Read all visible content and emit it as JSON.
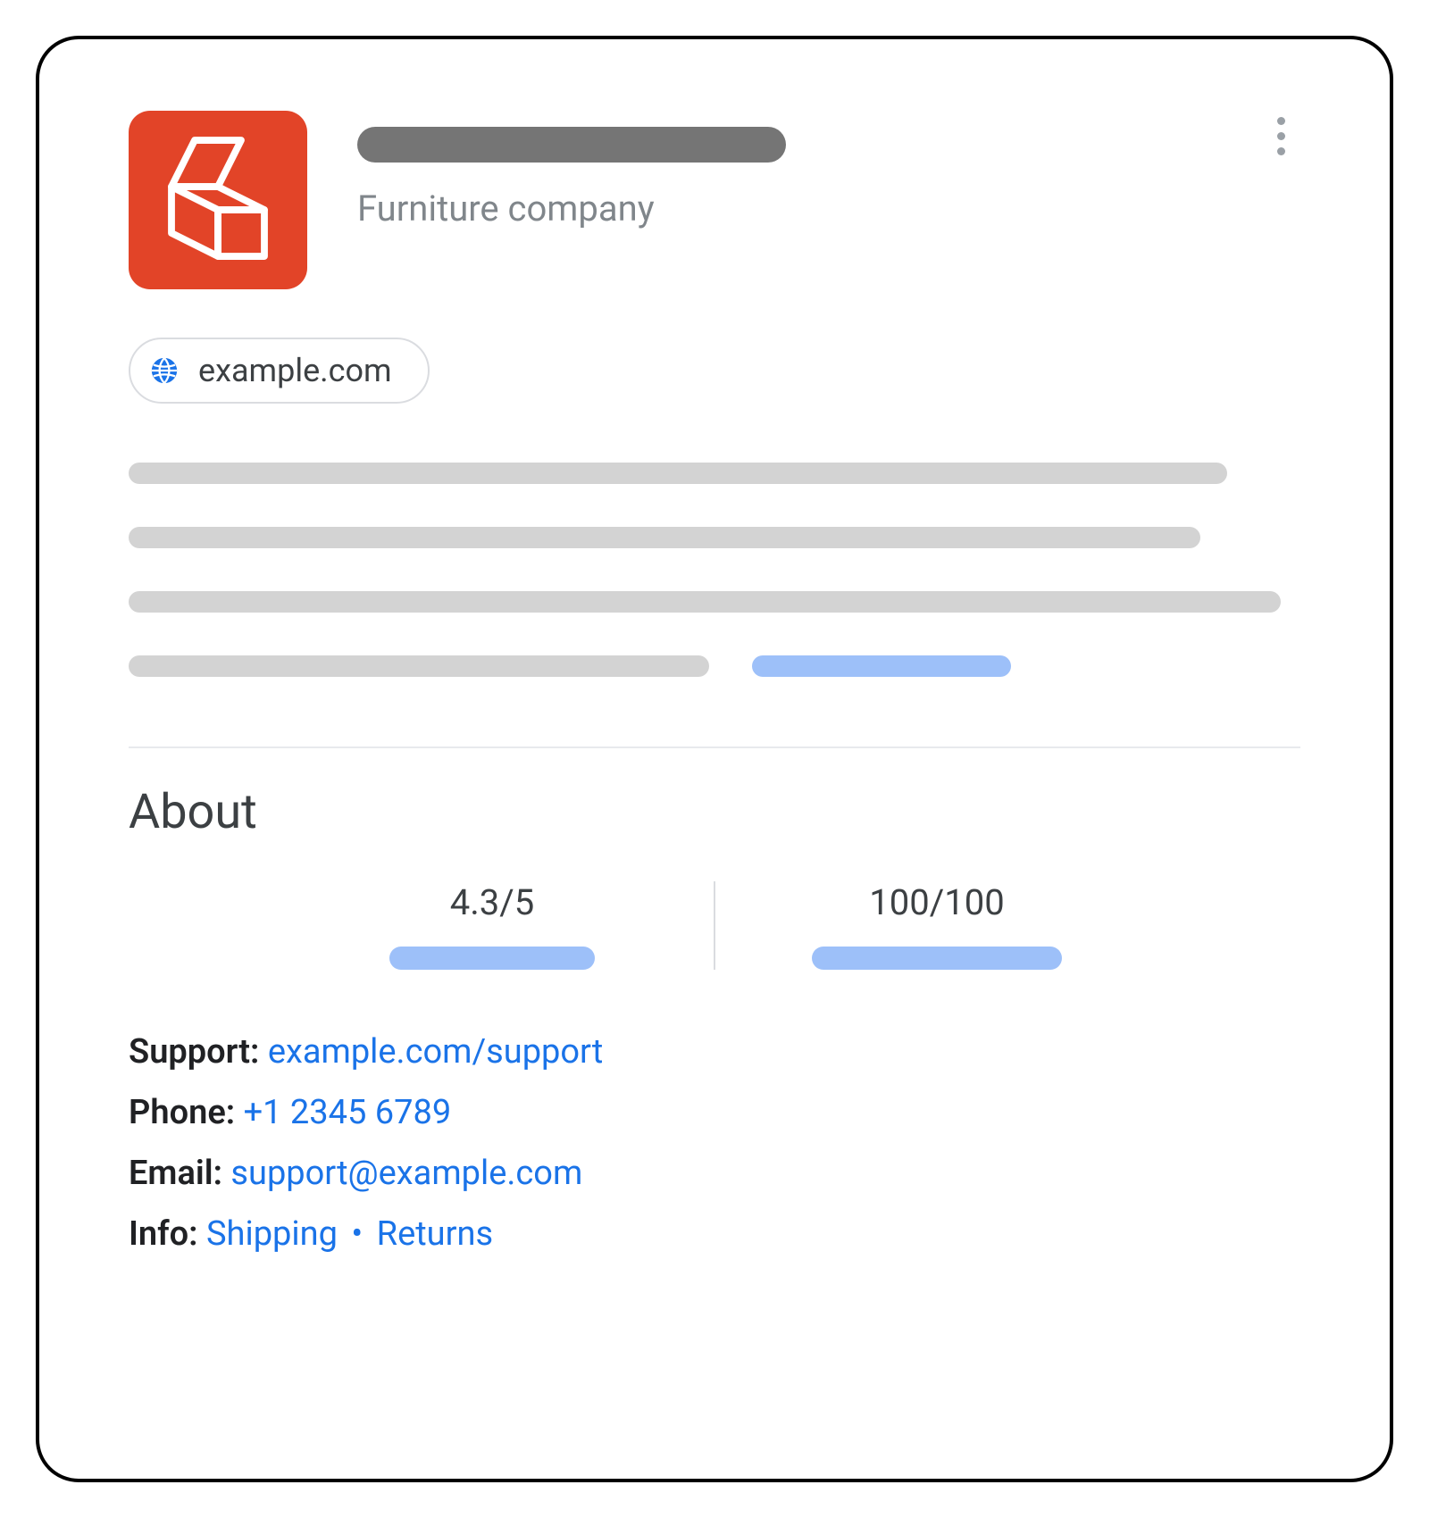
{
  "header": {
    "subtitle": "Furniture company"
  },
  "chip": {
    "domain": "example.com"
  },
  "about": {
    "heading": "About",
    "rating": "4.3/5",
    "score": "100/100"
  },
  "contact": {
    "support_label": "Support:",
    "support_link": "example.com/support",
    "phone_label": "Phone:",
    "phone_link": "+1 2345 6789",
    "email_label": "Email:",
    "email_link": "support@example.com",
    "info_label": "Info:",
    "info_link_shipping": "Shipping",
    "info_separator": "•",
    "info_link_returns": "Returns"
  }
}
